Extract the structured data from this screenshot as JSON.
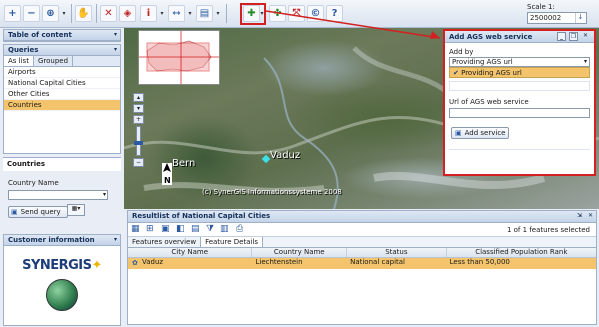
{
  "toolbar": {
    "scale_label": "Scale 1:",
    "scale_value": "2500002"
  },
  "left": {
    "toc_title": "Table of content",
    "queries_title": "Queries",
    "tabs": [
      "As list",
      "Grouped"
    ],
    "query_items": [
      "Airports",
      "National Capital Cities",
      "Other Cities",
      "Countries"
    ],
    "countries_title": "Countries",
    "country_name_label": "Country Name",
    "country_name_value": "",
    "send_query_label": "Send query",
    "customer_title": "Customer information",
    "logo_text": "SYNERGIS"
  },
  "map": {
    "label_bern": "Bern",
    "label_vaduz": "Vaduz",
    "copyright": "(c) SynerGIS Informationssysteme 2008"
  },
  "dialog": {
    "title": "Add AGS web service",
    "add_by_label": "Add by",
    "add_by_value": "Providing AGS url",
    "option_selected": "Providing AGS url",
    "url_label": "Url of AGS web service",
    "url_value": "",
    "add_button": "Add service"
  },
  "results": {
    "title": "Resultlist of National Capital Cities",
    "status": "1 of 1 features selected",
    "tabs": [
      "Features overview",
      "Feature Details"
    ],
    "columns": [
      "City Name",
      "Country Name",
      "Status",
      "Classified Population Rank"
    ],
    "rows": [
      [
        "Vaduz",
        "Liechtenstein",
        "National capital",
        "Less than 50,000"
      ]
    ]
  },
  "colors": {
    "highlight_red": "#d42020",
    "selection": "#f4c46c",
    "panel_header": "#c3d3e8"
  }
}
